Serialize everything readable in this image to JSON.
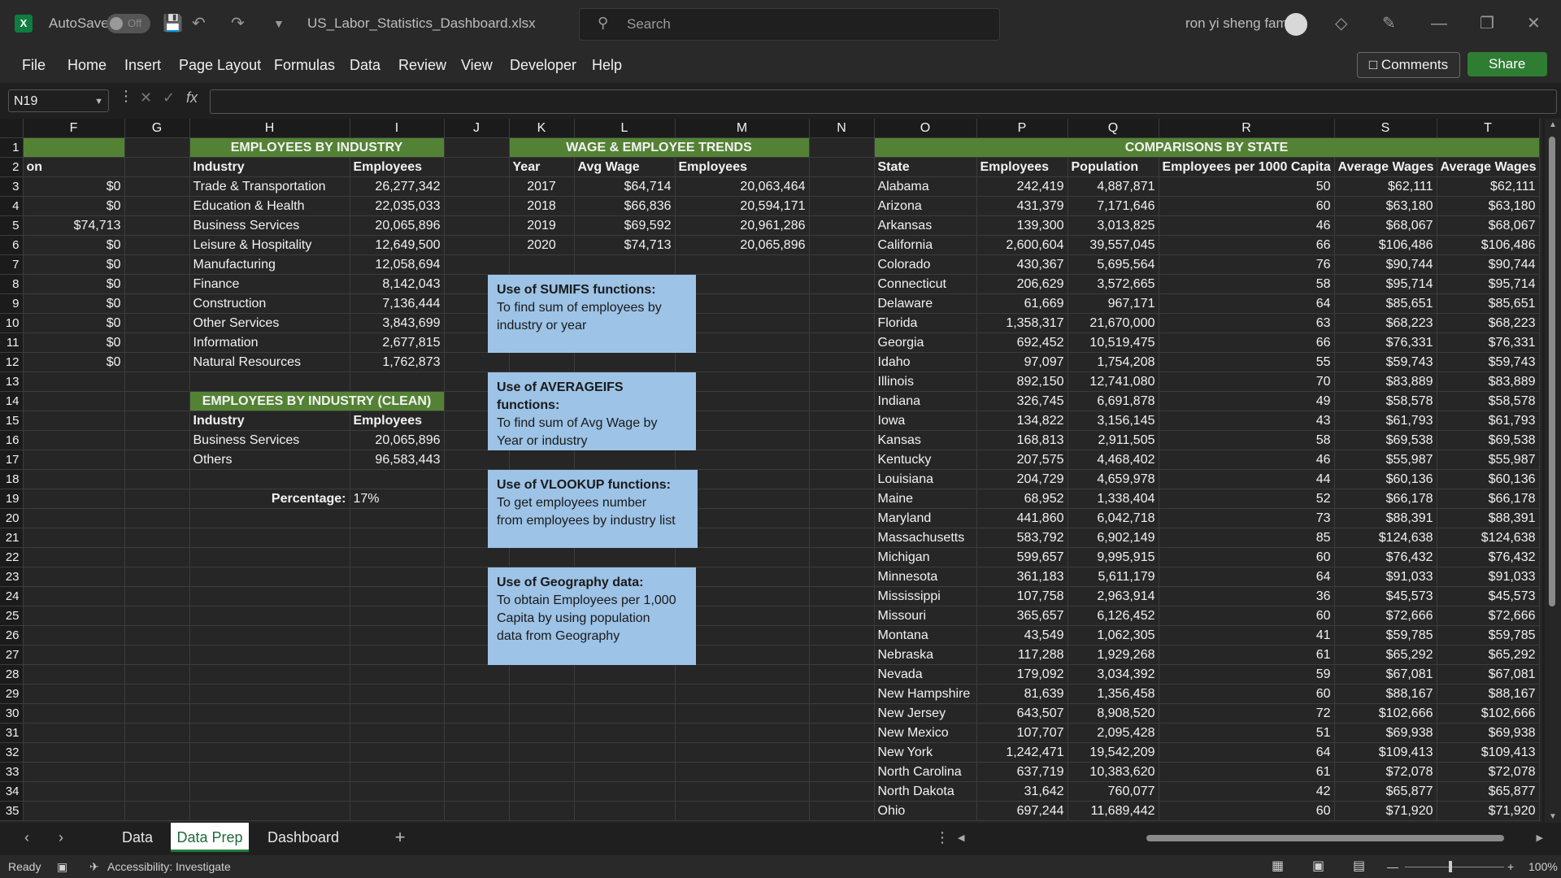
{
  "titlebar": {
    "autosave_label": "AutoSave",
    "autosave_state": "Off",
    "filename": "US_Labor_Statistics_Dashboard.xlsx",
    "search_placeholder": "Search",
    "user_name": "ron yi sheng fam"
  },
  "menu": [
    "File",
    "Home",
    "Insert",
    "Page Layout",
    "Formulas",
    "Data",
    "Review",
    "View",
    "Developer",
    "Help"
  ],
  "buttons": {
    "comments": "Comments",
    "share": "Share"
  },
  "formula_bar": {
    "name_box": "N19",
    "fx": "fx",
    "value": ""
  },
  "columns": [
    "F",
    "G",
    "H",
    "I",
    "J",
    "K",
    "L",
    "M",
    "N",
    "O",
    "P",
    "Q",
    "R",
    "S",
    "T"
  ],
  "rows": [
    "1",
    "2",
    "3",
    "4",
    "5",
    "6",
    "7",
    "8",
    "9",
    "10",
    "11",
    "12",
    "13",
    "14",
    "15",
    "16",
    "17",
    "18",
    "19",
    "20",
    "21",
    "22",
    "23",
    "24",
    "25",
    "26",
    "27",
    "28",
    "29",
    "30",
    "31",
    "32",
    "33",
    "34",
    "35"
  ],
  "colF": {
    "row2": "on",
    "values": [
      "$0",
      "$0",
      "$74,713",
      "$0",
      "$0",
      "$0",
      "$0",
      "$0",
      "$0",
      "$0"
    ]
  },
  "industry": {
    "title": "EMPLOYEES BY INDUSTRY",
    "headers": [
      "Industry",
      "Employees"
    ],
    "rows": [
      [
        "Trade & Transportation",
        "26,277,342"
      ],
      [
        "Education & Health",
        "22,035,033"
      ],
      [
        "Business Services",
        "20,065,896"
      ],
      [
        "Leisure & Hospitality",
        "12,649,500"
      ],
      [
        "Manufacturing",
        "12,058,694"
      ],
      [
        "Finance",
        "8,142,043"
      ],
      [
        "Construction",
        "7,136,444"
      ],
      [
        "Other Services",
        "3,843,699"
      ],
      [
        "Information",
        "2,677,815"
      ],
      [
        "Natural Resources",
        "1,762,873"
      ]
    ]
  },
  "industry_clean": {
    "title": "EMPLOYEES BY INDUSTRY (CLEAN)",
    "headers": [
      "Industry",
      "Employees"
    ],
    "rows": [
      [
        "Business Services",
        "20,065,896"
      ],
      [
        "Others",
        "96,583,443"
      ]
    ],
    "pct_label": "Percentage:",
    "pct_value": "17%"
  },
  "trends": {
    "title": "WAGE & EMPLOYEE TRENDS",
    "headers": [
      "Year",
      "Avg Wage",
      "Employees"
    ],
    "rows": [
      [
        "2017",
        "$64,714",
        "20,063,464"
      ],
      [
        "2018",
        "$66,836",
        "20,594,171"
      ],
      [
        "2019",
        "$69,592",
        "20,961,286"
      ],
      [
        "2020",
        "$74,713",
        "20,065,896"
      ]
    ]
  },
  "notes": [
    {
      "title": "Use of SUMIFS functions:",
      "lines": [
        "To find sum of employees by",
        "industry or year"
      ]
    },
    {
      "title": "Use of AVERAGEIFS functions:",
      "lines": [
        "To find sum of Avg Wage by",
        "Year or industry"
      ]
    },
    {
      "title": "Use of VLOOKUP functions:",
      "lines": [
        "To get employees number",
        "from employees by industry list"
      ]
    },
    {
      "title": "Use of Geography data:",
      "lines": [
        "To obtain Employees per 1,000",
        "Capita by using population",
        "data from Geography"
      ]
    }
  ],
  "states": {
    "title": "COMPARISONS BY STATE",
    "headers": [
      "State",
      "Employees",
      "Population",
      "Employees per 1000 Capita",
      "Average Wages",
      "Average Wages"
    ],
    "rows": [
      [
        "Alabama",
        "242,419",
        "4,887,871",
        "50",
        "$62,111",
        "$62,111"
      ],
      [
        "Arizona",
        "431,379",
        "7,171,646",
        "60",
        "$63,180",
        "$63,180"
      ],
      [
        "Arkansas",
        "139,300",
        "3,013,825",
        "46",
        "$68,067",
        "$68,067"
      ],
      [
        "California",
        "2,600,604",
        "39,557,045",
        "66",
        "$106,486",
        "$106,486"
      ],
      [
        "Colorado",
        "430,367",
        "5,695,564",
        "76",
        "$90,744",
        "$90,744"
      ],
      [
        "Connecticut",
        "206,629",
        "3,572,665",
        "58",
        "$95,714",
        "$95,714"
      ],
      [
        "Delaware",
        "61,669",
        "967,171",
        "64",
        "$85,651",
        "$85,651"
      ],
      [
        "Florida",
        "1,358,317",
        "21,670,000",
        "63",
        "$68,223",
        "$68,223"
      ],
      [
        "Georgia",
        "692,452",
        "10,519,475",
        "66",
        "$76,331",
        "$76,331"
      ],
      [
        "Idaho",
        "97,097",
        "1,754,208",
        "55",
        "$59,743",
        "$59,743"
      ],
      [
        "Illinois",
        "892,150",
        "12,741,080",
        "70",
        "$83,889",
        "$83,889"
      ],
      [
        "Indiana",
        "326,745",
        "6,691,878",
        "49",
        "$58,578",
        "$58,578"
      ],
      [
        "Iowa",
        "134,822",
        "3,156,145",
        "43",
        "$61,793",
        "$61,793"
      ],
      [
        "Kansas",
        "168,813",
        "2,911,505",
        "58",
        "$69,538",
        "$69,538"
      ],
      [
        "Kentucky",
        "207,575",
        "4,468,402",
        "46",
        "$55,987",
        "$55,987"
      ],
      [
        "Louisiana",
        "204,729",
        "4,659,978",
        "44",
        "$60,136",
        "$60,136"
      ],
      [
        "Maine",
        "68,952",
        "1,338,404",
        "52",
        "$66,178",
        "$66,178"
      ],
      [
        "Maryland",
        "441,860",
        "6,042,718",
        "73",
        "$88,391",
        "$88,391"
      ],
      [
        "Massachusetts",
        "583,792",
        "6,902,149",
        "85",
        "$124,638",
        "$124,638"
      ],
      [
        "Michigan",
        "599,657",
        "9,995,915",
        "60",
        "$76,432",
        "$76,432"
      ],
      [
        "Minnesota",
        "361,183",
        "5,611,179",
        "64",
        "$91,033",
        "$91,033"
      ],
      [
        "Mississippi",
        "107,758",
        "2,963,914",
        "36",
        "$45,573",
        "$45,573"
      ],
      [
        "Missouri",
        "365,657",
        "6,126,452",
        "60",
        "$72,666",
        "$72,666"
      ],
      [
        "Montana",
        "43,549",
        "1,062,305",
        "41",
        "$59,785",
        "$59,785"
      ],
      [
        "Nebraska",
        "117,288",
        "1,929,268",
        "61",
        "$65,292",
        "$65,292"
      ],
      [
        "Nevada",
        "179,092",
        "3,034,392",
        "59",
        "$67,081",
        "$67,081"
      ],
      [
        "New Hampshire",
        "81,639",
        "1,356,458",
        "60",
        "$88,167",
        "$88,167"
      ],
      [
        "New Jersey",
        "643,507",
        "8,908,520",
        "72",
        "$102,666",
        "$102,666"
      ],
      [
        "New Mexico",
        "107,707",
        "2,095,428",
        "51",
        "$69,938",
        "$69,938"
      ],
      [
        "New York",
        "1,242,471",
        "19,542,209",
        "64",
        "$109,413",
        "$109,413"
      ],
      [
        "North Carolina",
        "637,719",
        "10,383,620",
        "61",
        "$72,078",
        "$72,078"
      ],
      [
        "North Dakota",
        "31,642",
        "760,077",
        "42",
        "$65,877",
        "$65,877"
      ],
      [
        "Ohio",
        "697,244",
        "11,689,442",
        "60",
        "$71,920",
        "$71,920"
      ]
    ]
  },
  "sheet_tabs": {
    "items": [
      "Data",
      "Data Prep",
      "Dashboard"
    ],
    "active": "Data Prep",
    "add": "+"
  },
  "status": {
    "ready": "Ready",
    "accessibility": "Accessibility: Investigate",
    "zoom": "100%"
  }
}
